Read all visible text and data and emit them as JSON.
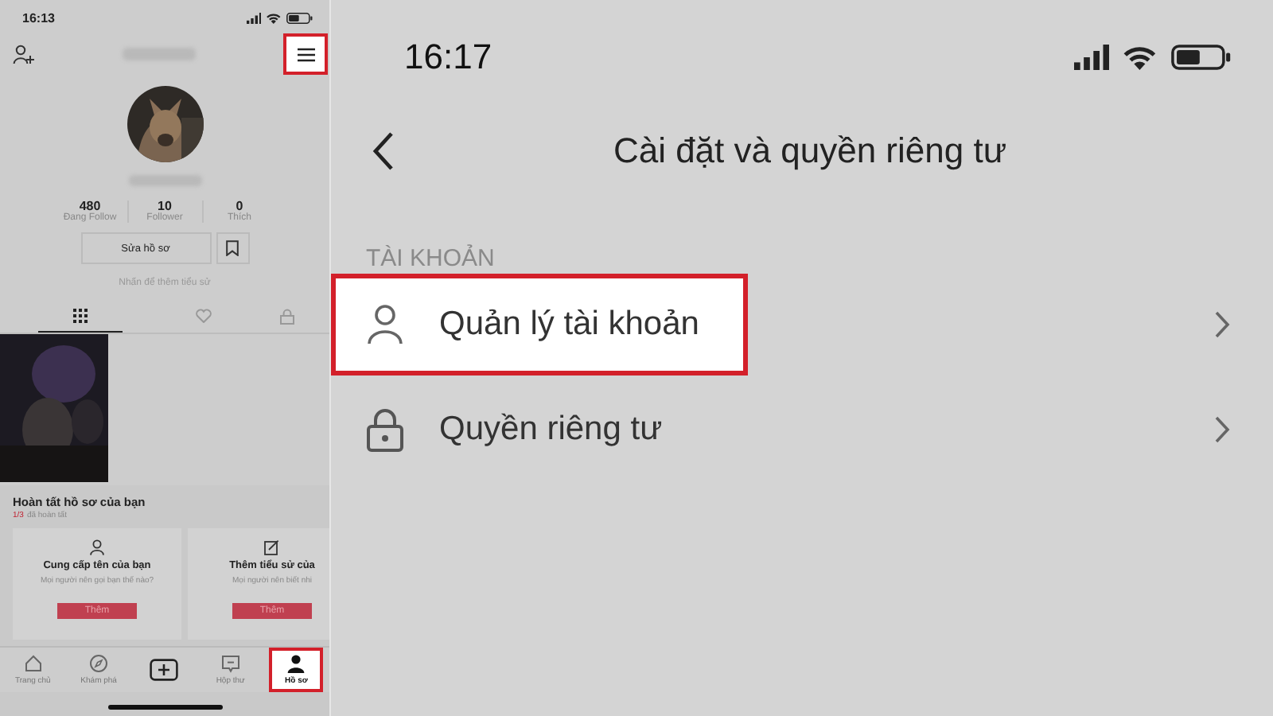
{
  "left_screen": {
    "status_time": "16:13",
    "menu_highlighted": true,
    "stats": [
      {
        "value": "480",
        "label": "Đang Follow"
      },
      {
        "value": "10",
        "label": "Follower"
      },
      {
        "value": "0",
        "label": "Thích"
      }
    ],
    "edit_button": "Sửa hồ sơ",
    "bio_hint": "Nhấn để thêm tiểu sử",
    "tabs": [
      {
        "kind": "grid",
        "selected": true
      },
      {
        "kind": "heart",
        "selected": false
      },
      {
        "kind": "lock",
        "selected": false
      }
    ],
    "section_title": "Hoàn tất hồ sơ của bạn",
    "progress_count": "1/3",
    "progress_label": "đã hoàn tất",
    "cards": [
      {
        "kind": "person",
        "title": "Cung cấp tên của bạn",
        "subtitle": "Mọi người nên gọi bạn thế nào?",
        "button": "Thêm"
      },
      {
        "kind": "edit",
        "title": "Thêm tiểu sử của",
        "subtitle": "Mọi người nên biết nhi",
        "button": "Thêm"
      }
    ],
    "nav": [
      {
        "kind": "home",
        "label": "Trang chủ",
        "highlighted": false
      },
      {
        "kind": "compass",
        "label": "Khám phá",
        "highlighted": false
      },
      {
        "kind": "plus",
        "highlighted": false
      },
      {
        "kind": "inbox",
        "label": "Hộp thư",
        "highlighted": false
      },
      {
        "kind": "profile",
        "label": "Hồ sơ",
        "highlighted": true
      }
    ]
  },
  "right_screen": {
    "status_time": "16:17",
    "title": "Cài đặt và quyền riêng tư",
    "section": "TÀI KHOẢN",
    "items": [
      {
        "kind": "person",
        "label": "Quản lý tài khoản",
        "highlighted": true
      },
      {
        "kind": "lock",
        "label": "Quyền riêng tư",
        "highlighted": false
      }
    ]
  }
}
